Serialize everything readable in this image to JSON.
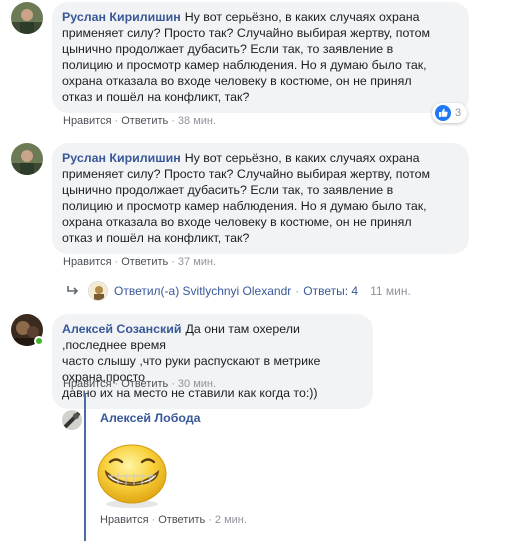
{
  "comments": [
    {
      "author": "Руслан Кирилишин",
      "lines": [
        "Ну вот серьёзно, в каких случаях охрана",
        "применяет силу? Просто так? Случайно выбирая жертву, потом",
        "цынично продолжает дубасить? Если так, то заявление в",
        "полицию и просмотр камер наблюдения. Но я думаю было так,",
        "охрана отказала во входе человеку в костюме, он не принял",
        "отказ и пошёл на конфликт, так?"
      ],
      "like": "Нравится",
      "reply": "Ответить",
      "time": "38 мин.",
      "reactions": "3"
    },
    {
      "author": "Руслан Кирилишин",
      "lines": [
        "Ну вот серьёзно, в каких случаях охрана",
        "применяет силу? Просто так? Случайно выбирая жертву, потом",
        "цынично продолжает дубасить? Если так, то заявление в",
        "полицию и просмотр камер наблюдения. Но я думаю было так,",
        "охрана отказала во входе человеку в костюме, он не принял",
        "отказ и пошёл на конфликт, так?"
      ],
      "like": "Нравится",
      "reply": "Ответить",
      "time": "37 мин.",
      "replies_summary": {
        "prefix": "Ответил(-а) Svitlychnyi Olexandr",
        "count": "Ответы: 4",
        "time": "11 мин."
      }
    },
    {
      "author": "Алексей Созанский",
      "lines": [
        "Да они там охерели ,последнее время",
        "часто слышу ,что руки распускают в метрике охрана,просто",
        "давно их на место не ставили как когда то:))"
      ],
      "like": "Нравится",
      "reply": "Ответить",
      "time": "30 мин."
    }
  ],
  "nested_reply": {
    "author": "Алексей Лобода",
    "sticker": "grinning-face-sticker",
    "like": "Нравится",
    "reply": "Ответить",
    "time": "2 мин."
  },
  "colors": {
    "link": "#385898",
    "bubble": "#f2f3f5",
    "like_blue": "#2078f4",
    "online": "#42b72a"
  }
}
